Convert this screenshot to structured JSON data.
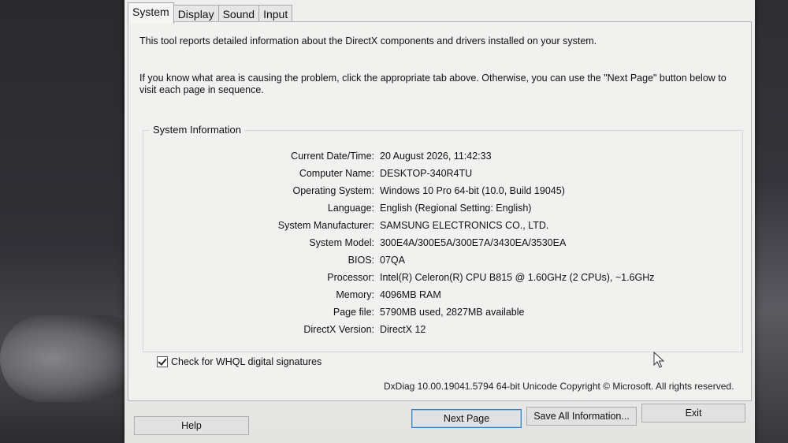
{
  "tabs": [
    "System",
    "Display",
    "Sound",
    "Input"
  ],
  "intro_line1": "This tool reports detailed information about the DirectX components and drivers installed on your system.",
  "intro_line2a": "If you know what area is causing the problem, click the appropriate tab above.  Otherwise, you can use the \"Next Page\" button below to",
  "intro_line2b": "visit each page in sequence.",
  "group_title": "System Information",
  "info": [
    {
      "label": "Current Date/Time:",
      "value": "20 August 2026, 11:42:33"
    },
    {
      "label": "Computer Name:",
      "value": "DESKTOP-340R4TU"
    },
    {
      "label": "Operating System:",
      "value": "Windows 10 Pro 64-bit (10.0, Build 19045)"
    },
    {
      "label": "Language:",
      "value": "English (Regional Setting: English)"
    },
    {
      "label": "System Manufacturer:",
      "value": "SAMSUNG ELECTRONICS CO., LTD."
    },
    {
      "label": "System Model:",
      "value": "300E4A/300E5A/300E7A/3430EA/3530EA"
    },
    {
      "label": "BIOS:",
      "value": "07QA"
    },
    {
      "label": "Processor:",
      "value": "Intel(R) Celeron(R) CPU B815 @ 1.60GHz (2 CPUs), ~1.6GHz"
    },
    {
      "label": "Memory:",
      "value": "4096MB RAM"
    },
    {
      "label": "Page file:",
      "value": "5790MB used, 2827MB available"
    },
    {
      "label": "DirectX Version:",
      "value": "DirectX 12"
    }
  ],
  "whql_label": "Check for WHQL digital signatures",
  "whql_checked": true,
  "copyright": "DxDiag 10.00.19041.5794 64-bit Unicode  Copyright © Microsoft. All rights reserved.",
  "buttons": {
    "help": "Help",
    "next_page": "Next Page",
    "save_all": "Save All Information...",
    "exit": "Exit"
  }
}
